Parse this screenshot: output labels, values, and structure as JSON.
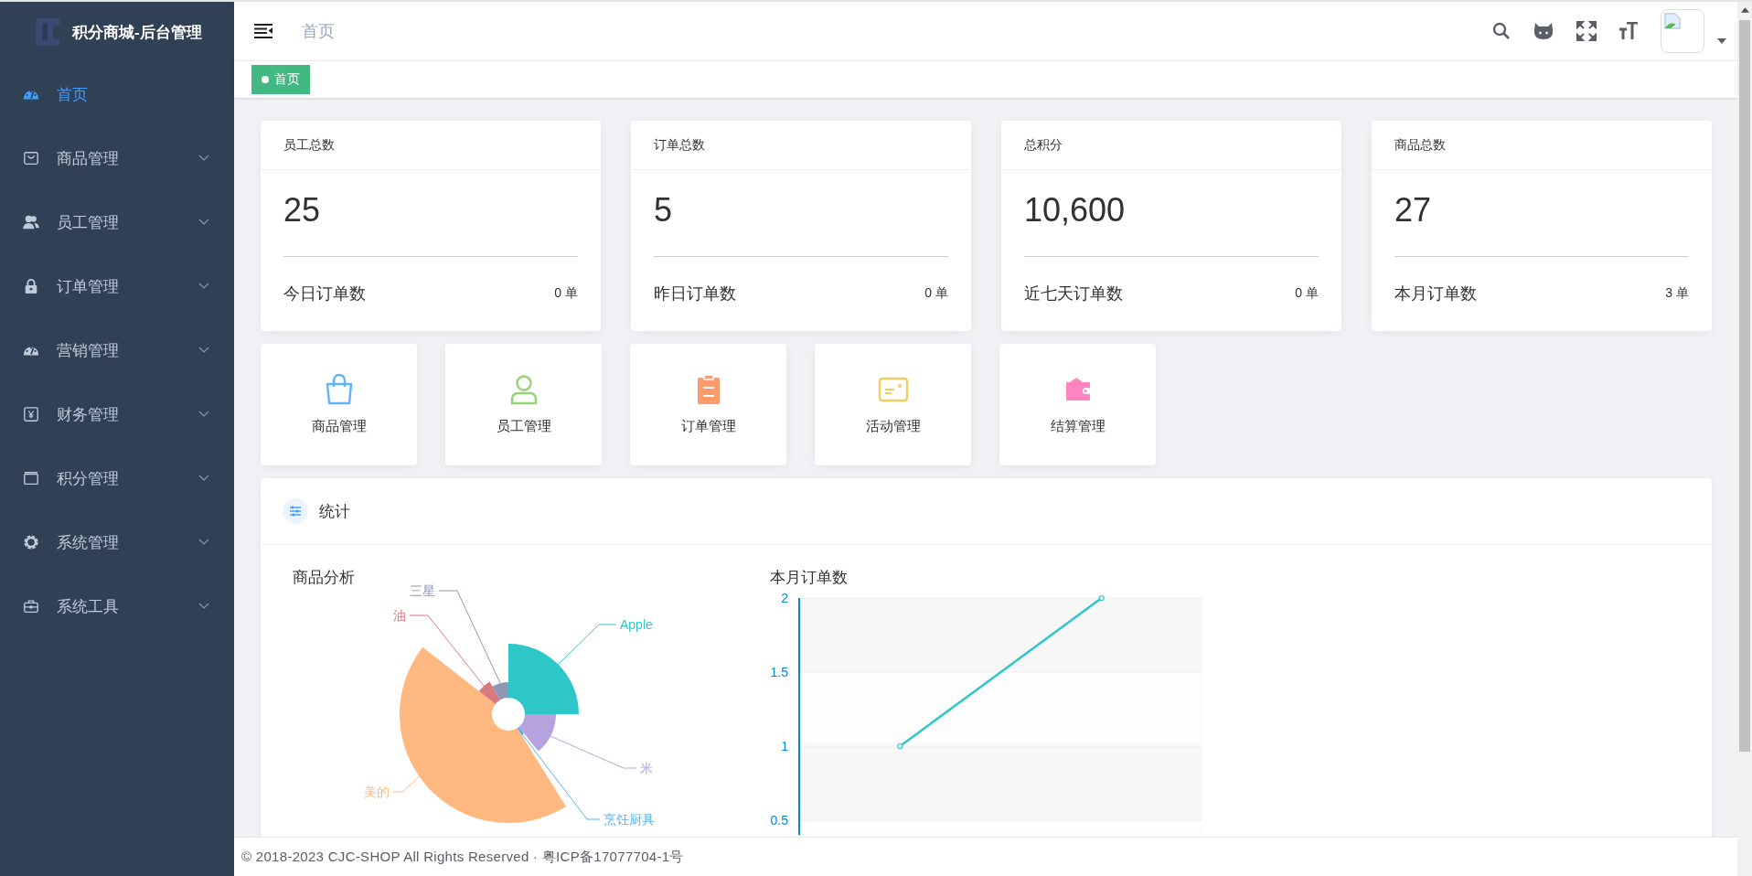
{
  "sidebar": {
    "title": "积分商城-后台管理",
    "items": [
      {
        "label": "首页",
        "selected": true,
        "expandable": false
      },
      {
        "label": "商品管理",
        "selected": false,
        "expandable": true
      },
      {
        "label": "员工管理",
        "selected": false,
        "expandable": true
      },
      {
        "label": "订单管理",
        "selected": false,
        "expandable": true
      },
      {
        "label": "营销管理",
        "selected": false,
        "expandable": true
      },
      {
        "label": "财务管理",
        "selected": false,
        "expandable": true
      },
      {
        "label": "积分管理",
        "selected": false,
        "expandable": true
      },
      {
        "label": "系统管理",
        "selected": false,
        "expandable": true
      },
      {
        "label": "系统工具",
        "selected": false,
        "expandable": true
      }
    ]
  },
  "header": {
    "breadcrumb": "首页"
  },
  "tags": [
    {
      "label": "首页",
      "selected": true
    }
  ],
  "stat_cards": [
    {
      "title": "员工总数",
      "value": "25",
      "sub_label": "今日订单数",
      "sub_value": "0 单"
    },
    {
      "title": "订单总数",
      "value": "5",
      "sub_label": "昨日订单数",
      "sub_value": "0 单"
    },
    {
      "title": "总积分",
      "value": "10,600",
      "sub_label": "近七天订单数",
      "sub_value": "0 单"
    },
    {
      "title": "商品总数",
      "value": "27",
      "sub_label": "本月订单数",
      "sub_value": "3 单"
    }
  ],
  "shortcuts": [
    {
      "label": "商品管理",
      "color": "#5cb3ff"
    },
    {
      "label": "员工管理",
      "color": "#95d475"
    },
    {
      "label": "订单管理",
      "color": "#ff9b6a"
    },
    {
      "label": "活动管理",
      "color": "#f7cc5e"
    },
    {
      "label": "结算管理",
      "color": "#ff85c0"
    }
  ],
  "stats_panel": {
    "title": "统计",
    "pie": {
      "title": "商品分析",
      "slices": [
        {
          "label": "Apple",
          "color": "#2ec7c9"
        },
        {
          "label": "米",
          "color": "#b6a2de"
        },
        {
          "label": "烹饪厨具",
          "color": "#5ab1ef"
        },
        {
          "label": "美的",
          "color": "#ffb980"
        },
        {
          "label": "油",
          "color": "#d87a80"
        },
        {
          "label": "三星",
          "color": "#8d98b3"
        }
      ]
    },
    "line": {
      "chart_data": {
        "type": "line",
        "title": "本月订单数",
        "series": [
          {
            "color": "#2ec7c9",
            "marker": true,
            "values": [
              1,
              2
            ]
          }
        ],
        "ylim": [
          0.4,
          2
        ],
        "grid": true,
        "yticks": [
          0.5,
          1,
          1.5,
          2
        ]
      }
    }
  },
  "footer": "© 2018-2023 CJC-SHOP All Rights Reserved · 粤ICP备17077704-1号"
}
